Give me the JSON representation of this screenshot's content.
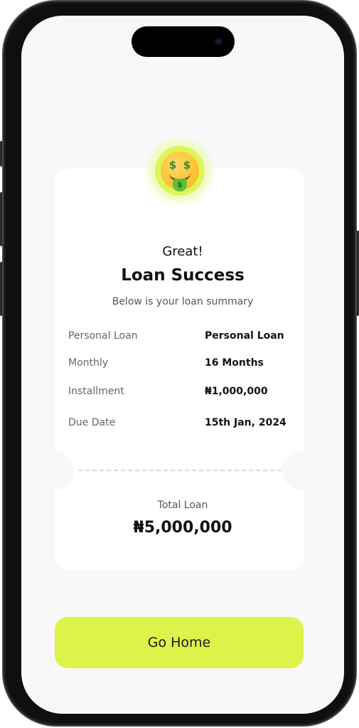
{
  "header": {
    "emoji_icon": "money-mouth-face-icon",
    "greeting": "Great!",
    "title": "Loan Success",
    "subtitle": "Below is your loan summary"
  },
  "summary": {
    "rows": [
      {
        "label": "Personal Loan",
        "value": "Personal Loan"
      },
      {
        "label": "Monthly",
        "value": "16 Months"
      },
      {
        "label": "Installment",
        "value": "₦1,000,000"
      },
      {
        "label": "Due Date",
        "value": "15th Jan, 2024"
      }
    ]
  },
  "total": {
    "label": "Total Loan",
    "value": "₦5,000,000"
  },
  "cta": {
    "label": "Go Home"
  },
  "colors": {
    "accent": "#ddf34a",
    "screen_bg": "#f8f8f8",
    "card_bg": "#ffffff"
  }
}
